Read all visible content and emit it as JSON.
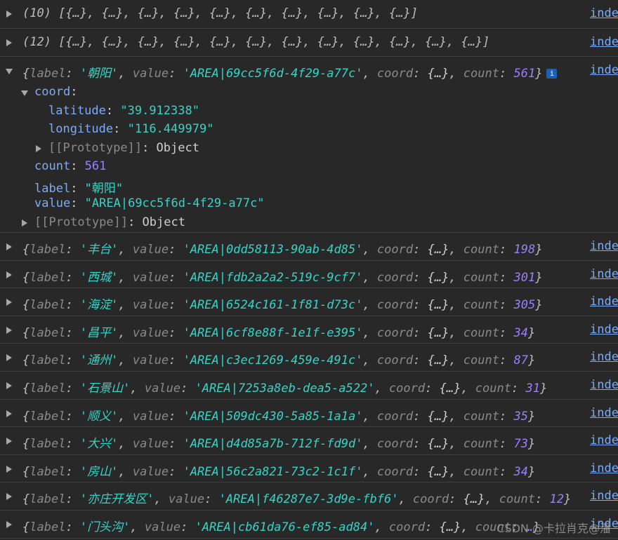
{
  "link_text": "inde",
  "watermark": "CSDN @卡拉肖克@潘",
  "arrays": [
    {
      "count_label": "(10)",
      "items": "[{…}, {…}, {…}, {…}, {…}, {…}, {…}, {…}, {…}, {…}]"
    },
    {
      "count_label": "(12)",
      "items": "[{…}, {…}, {…}, {…}, {…}, {…}, {…}, {…}, {…}, {…}, {…}, {…}]"
    }
  ],
  "expanded": {
    "label": "'朝阳'",
    "value": "'AREA|69cc5f6d-4f29-a77c'",
    "coord": "{…}",
    "count": "561",
    "info_icon": "i",
    "coord_key": "coord",
    "latitude_key": "latitude",
    "latitude": "\"39.912338\"",
    "longitude_key": "longitude",
    "longitude": "\"116.449979\"",
    "proto_key": "[[Prototype]]",
    "proto_val": "Object",
    "count_key": "count",
    "count_val": "561",
    "label_key": "label",
    "label_val": "\"朝阳\"",
    "value_key": "value",
    "value_val": "\"AREA|69cc5f6d-4f29-a77c\""
  },
  "rows": [
    {
      "label": "'丰台'",
      "value": "'AREA|0dd58113-90ab-4d85'",
      "coord": "{…}",
      "count": "198"
    },
    {
      "label": "'西城'",
      "value": "'AREA|fdb2a2a2-519c-9cf7'",
      "coord": "{…}",
      "count": "301"
    },
    {
      "label": "'海淀'",
      "value": "'AREA|6524c161-1f81-d73c'",
      "coord": "{…}",
      "count": "305"
    },
    {
      "label": "'昌平'",
      "value": "'AREA|6cf8e88f-1e1f-e395'",
      "coord": "{…}",
      "count": "34"
    },
    {
      "label": "'通州'",
      "value": "'AREA|c3ec1269-459e-491c'",
      "coord": "{…}",
      "count": "87"
    },
    {
      "label": "'石景山'",
      "value": "'AREA|7253a8eb-dea5-a522'",
      "coord": "{…}",
      "count": "31"
    },
    {
      "label": "'顺义'",
      "value": "'AREA|509dc430-5a85-1a1a'",
      "coord": "{…}",
      "count": "35"
    },
    {
      "label": "'大兴'",
      "value": "'AREA|d4d85a7b-712f-fd9d'",
      "coord": "{…}",
      "count": "73"
    },
    {
      "label": "'房山'",
      "value": "'AREA|56c2a821-73c2-1c1f'",
      "coord": "{…}",
      "count": "34"
    },
    {
      "label": "'亦庄开发区'",
      "value": "'AREA|f46287e7-3d9e-fbf6'",
      "coord": "{…}",
      "count": "12"
    },
    {
      "label": "'门头沟'",
      "value": "'AREA|cb61da76-ef85-ad84'",
      "coord": "{…}",
      "count": "…"
    }
  ],
  "keys": {
    "label": "label",
    "value": "value",
    "coord": "coord",
    "count": "count"
  }
}
